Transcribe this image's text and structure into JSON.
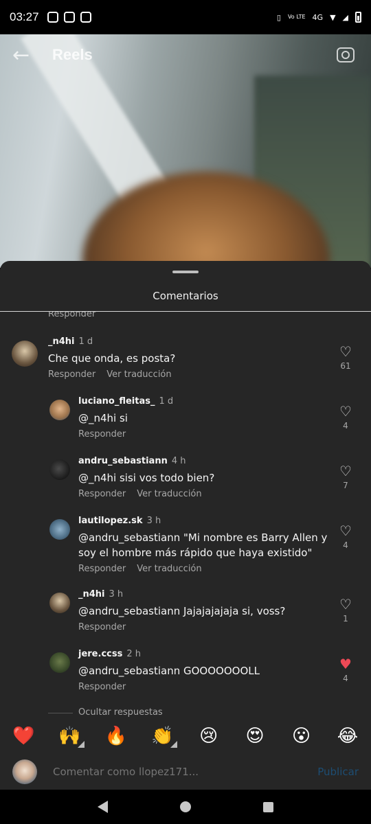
{
  "status_bar": {
    "time": "03:27",
    "network": "4G",
    "volte": "Vo LTE"
  },
  "reel": {
    "title": "Reels",
    "back_icon": "back-arrow-icon",
    "camera_icon": "camera-icon"
  },
  "sheet": {
    "title": "Comentarios",
    "cut_reply_label": "Responder",
    "comments": [
      {
        "user": "_n4hi",
        "time": "1 d",
        "text": "Che que onda, es posta?",
        "reply": "Responder",
        "translate": "Ver traducción",
        "likes": "61",
        "liked": false
      },
      {
        "user": "luciano_fleitas_",
        "time": "1 d",
        "text": "@_n4hi si",
        "reply": "Responder",
        "translate": "",
        "likes": "4",
        "liked": false
      },
      {
        "user": "andru_sebastiann",
        "time": "4 h",
        "text": "@_n4hi sisi vos todo bien?",
        "reply": "Responder",
        "translate": "Ver traducción",
        "likes": "7",
        "liked": false
      },
      {
        "user": "lautilopez.sk",
        "time": "3 h",
        "text": "@andru_sebastiann \"Mi nombre es Barry Allen y soy el hombre más rápido que haya existido\"",
        "reply": "Responder",
        "translate": "Ver traducción",
        "likes": "4",
        "liked": false
      },
      {
        "user": "_n4hi",
        "time": "3 h",
        "text": "@andru_sebastiann Jajajajajaja si, voss?",
        "reply": "Responder",
        "translate": "",
        "likes": "1",
        "liked": false
      },
      {
        "user": "jere.ccss",
        "time": "2 h",
        "text": "@andru_sebastiann GOOOOOOOLL",
        "reply": "Responder",
        "translate": "",
        "likes": "4",
        "liked": true
      }
    ],
    "hide_replies": "Ocultar respuestas"
  },
  "emoji_bar": [
    "❤️",
    "🙌",
    "🔥",
    "👏",
    "😢",
    "😍",
    "😮",
    "😂"
  ],
  "input": {
    "placeholder": "Comentar como llopez171...",
    "publish_label": "Publicar"
  },
  "colors": {
    "sheet_bg": "#262626",
    "like_active": "#ed4956",
    "publish": "#1d4d73"
  }
}
